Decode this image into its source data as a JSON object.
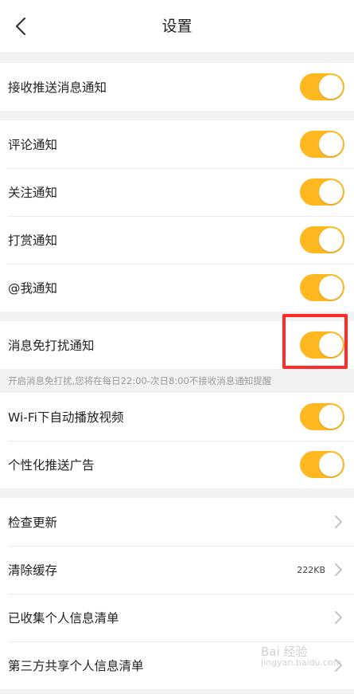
{
  "header": {
    "title": "设置",
    "back_icon": "chevron-left-icon"
  },
  "groups": {
    "push": [
      {
        "label": "接收推送消息通知",
        "on": true
      }
    ],
    "notifications": [
      {
        "label": "评论通知",
        "on": true
      },
      {
        "label": "关注通知",
        "on": true
      },
      {
        "label": "打赏通知",
        "on": true
      },
      {
        "label": "@我通知",
        "on": true
      }
    ],
    "dnd": {
      "label": "消息免打扰通知",
      "on": true,
      "hint": "开启消息免打扰,您将在每日22:00-次日8:00不接收消息通知提醒"
    },
    "media": [
      {
        "label": "Wi-Fi下自动播放视频",
        "on": true
      },
      {
        "label": "个性化推送广告",
        "on": true
      }
    ],
    "misc": [
      {
        "label": "检查更新",
        "value": ""
      },
      {
        "label": "清除缓存",
        "value": "222KB"
      },
      {
        "label": "已收集个人信息清单",
        "value": ""
      },
      {
        "label": "第三方共享个人信息清单",
        "value": ""
      }
    ]
  },
  "colors": {
    "accent": "#ffb820",
    "highlight": "#ff2a2a"
  },
  "watermark": {
    "line1": "Bai 经验",
    "line2": "jingyan.baidu.com"
  }
}
